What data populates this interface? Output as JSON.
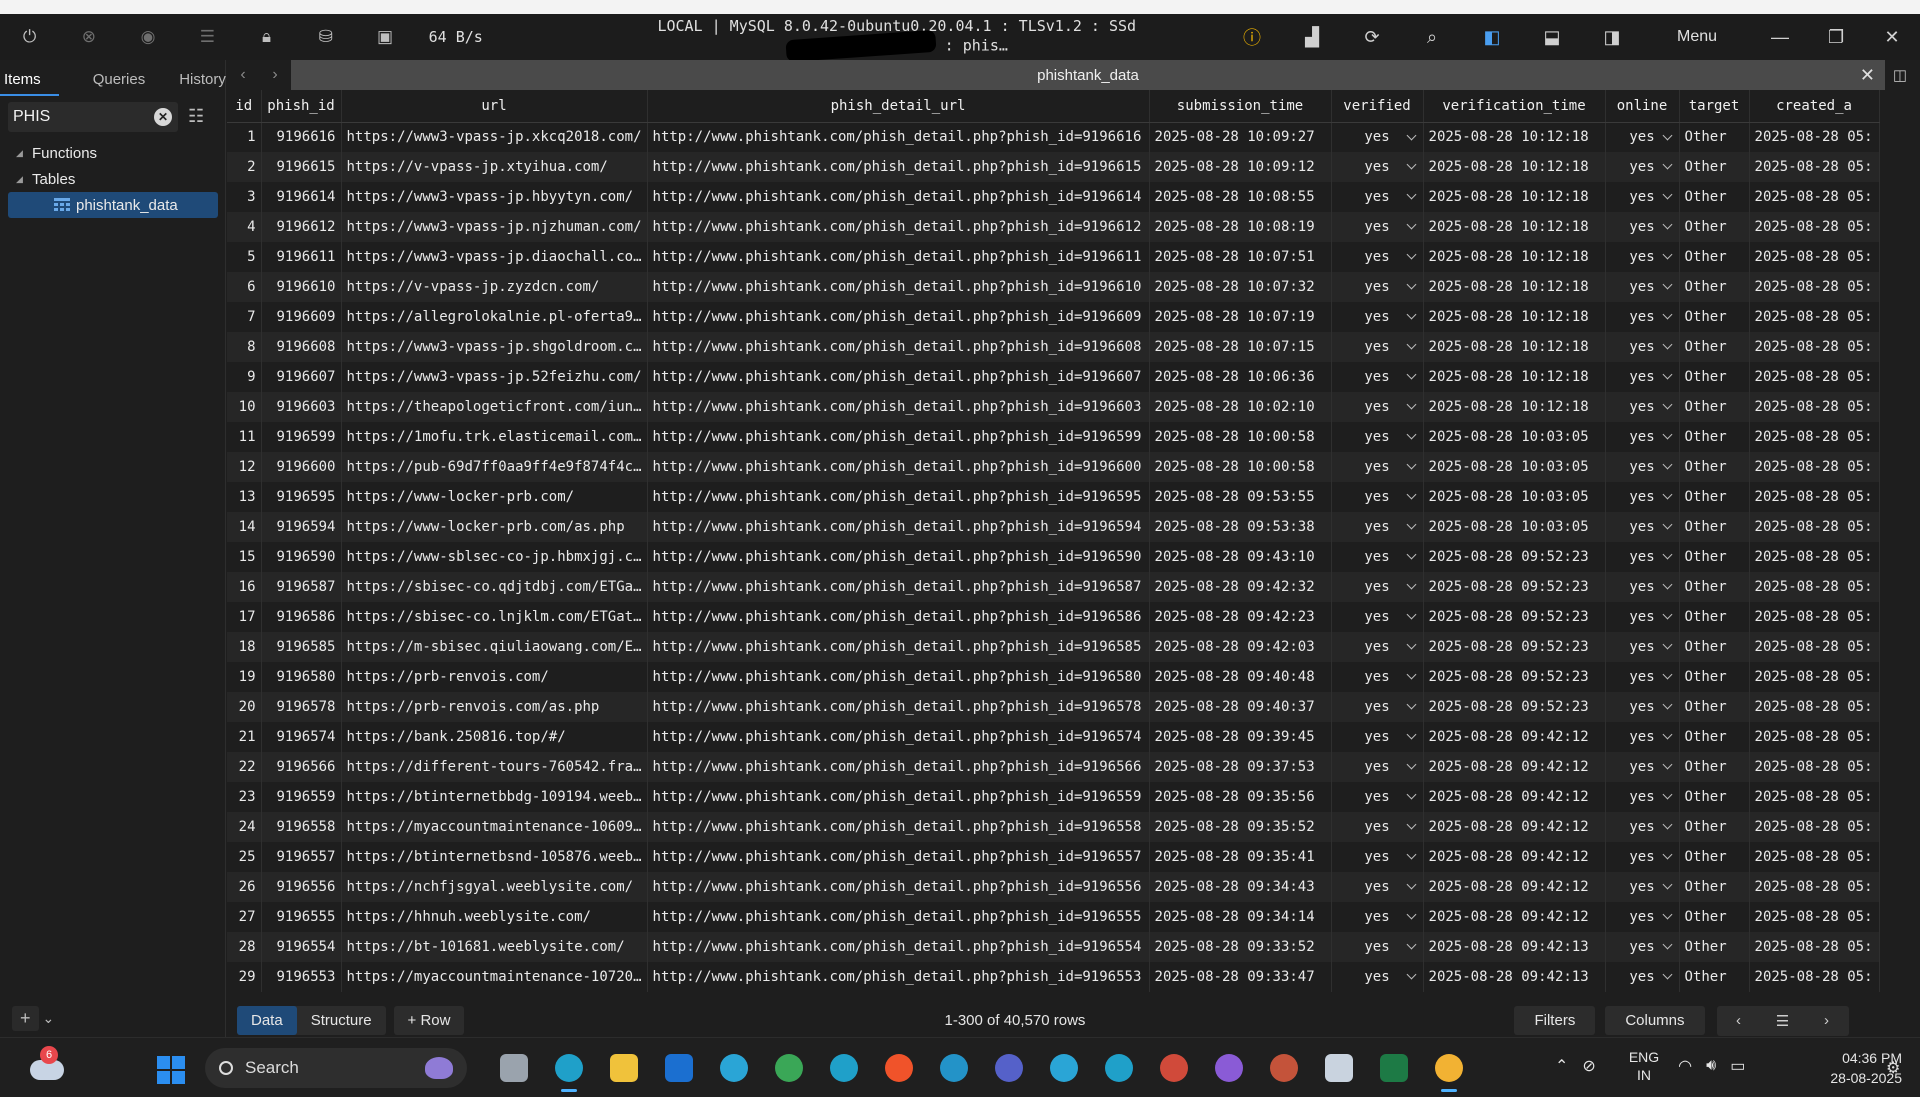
{
  "titlebar": {
    "speed": "64 B/s",
    "connection_prefix": "LOCAL | MySQL 8.0.42-0ubuntu0.20.04.1 : TLSv1.2 : SSd",
    "connection_suffix": ": phis…",
    "menu_label": "Menu",
    "icons": [
      "power-icon",
      "cancel-icon",
      "eye-icon",
      "log-icon",
      "lock-icon",
      "database-icon",
      "ssl-icon",
      "info-icon",
      "chart-icon",
      "refresh-icon",
      "search-icon",
      "layout-left-icon",
      "layout-bottom-icon",
      "layout-right-icon"
    ]
  },
  "sidebar": {
    "tabs": [
      "Items",
      "Queries",
      "History"
    ],
    "search_value": "PHIS",
    "tree": [
      {
        "label": "Functions"
      },
      {
        "label": "Tables"
      },
      {
        "label": "phishtank_data",
        "selected": true
      }
    ]
  },
  "tab": {
    "title": "phishtank_data"
  },
  "table": {
    "columns": [
      "id",
      "phish_id",
      "url",
      "phish_detail_url",
      "submission_time",
      "verified",
      "verification_time",
      "online",
      "target",
      "created_a"
    ],
    "rows": [
      [
        "1",
        "9196616",
        "https://www3-vpass-jp.xkcq2018.com/",
        "http://www.phishtank.com/phish_detail.php?phish_id=9196616",
        "2025-08-28 10:09:27",
        "yes",
        "2025-08-28 10:12:18",
        "yes",
        "Other",
        "2025-08-28 05:"
      ],
      [
        "2",
        "9196615",
        "https://v-vpass-jp.xtyihua.com/",
        "http://www.phishtank.com/phish_detail.php?phish_id=9196615",
        "2025-08-28 10:09:12",
        "yes",
        "2025-08-28 10:12:18",
        "yes",
        "Other",
        "2025-08-28 05:"
      ],
      [
        "3",
        "9196614",
        "https://www3-vpass-jp.hbyytyn.com/",
        "http://www.phishtank.com/phish_detail.php?phish_id=9196614",
        "2025-08-28 10:08:55",
        "yes",
        "2025-08-28 10:12:18",
        "yes",
        "Other",
        "2025-08-28 05:"
      ],
      [
        "4",
        "9196612",
        "https://www3-vpass-jp.njzhuman.com/",
        "http://www.phishtank.com/phish_detail.php?phish_id=9196612",
        "2025-08-28 10:08:19",
        "yes",
        "2025-08-28 10:12:18",
        "yes",
        "Other",
        "2025-08-28 05:"
      ],
      [
        "5",
        "9196611",
        "https://www3-vpass-jp.diaochall.co…",
        "http://www.phishtank.com/phish_detail.php?phish_id=9196611",
        "2025-08-28 10:07:51",
        "yes",
        "2025-08-28 10:12:18",
        "yes",
        "Other",
        "2025-08-28 05:"
      ],
      [
        "6",
        "9196610",
        "https://v-vpass-jp.zyzdcn.com/",
        "http://www.phishtank.com/phish_detail.php?phish_id=9196610",
        "2025-08-28 10:07:32",
        "yes",
        "2025-08-28 10:12:18",
        "yes",
        "Other",
        "2025-08-28 05:"
      ],
      [
        "7",
        "9196609",
        "https://allegrolokalnie.pl-oferta9…",
        "http://www.phishtank.com/phish_detail.php?phish_id=9196609",
        "2025-08-28 10:07:19",
        "yes",
        "2025-08-28 10:12:18",
        "yes",
        "Other",
        "2025-08-28 05:"
      ],
      [
        "8",
        "9196608",
        "https://www3-vpass-jp.shgoldroom.c…",
        "http://www.phishtank.com/phish_detail.php?phish_id=9196608",
        "2025-08-28 10:07:15",
        "yes",
        "2025-08-28 10:12:18",
        "yes",
        "Other",
        "2025-08-28 05:"
      ],
      [
        "9",
        "9196607",
        "https://www3-vpass-jp.52feizhu.com/",
        "http://www.phishtank.com/phish_detail.php?phish_id=9196607",
        "2025-08-28 10:06:36",
        "yes",
        "2025-08-28 10:12:18",
        "yes",
        "Other",
        "2025-08-28 05:"
      ],
      [
        "10",
        "9196603",
        "https://theapologeticfront.com/iun…",
        "http://www.phishtank.com/phish_detail.php?phish_id=9196603",
        "2025-08-28 10:02:10",
        "yes",
        "2025-08-28 10:12:18",
        "yes",
        "Other",
        "2025-08-28 05:"
      ],
      [
        "11",
        "9196599",
        "https://1mofu.trk.elasticemail.com…",
        "http://www.phishtank.com/phish_detail.php?phish_id=9196599",
        "2025-08-28 10:00:58",
        "yes",
        "2025-08-28 10:03:05",
        "yes",
        "Other",
        "2025-08-28 05:"
      ],
      [
        "12",
        "9196600",
        "https://pub-69d7ff0aa9ff4e9f874f4c…",
        "http://www.phishtank.com/phish_detail.php?phish_id=9196600",
        "2025-08-28 10:00:58",
        "yes",
        "2025-08-28 10:03:05",
        "yes",
        "Other",
        "2025-08-28 05:"
      ],
      [
        "13",
        "9196595",
        "https://www-locker-prb.com/",
        "http://www.phishtank.com/phish_detail.php?phish_id=9196595",
        "2025-08-28 09:53:55",
        "yes",
        "2025-08-28 10:03:05",
        "yes",
        "Other",
        "2025-08-28 05:"
      ],
      [
        "14",
        "9196594",
        "https://www-locker-prb.com/as.php",
        "http://www.phishtank.com/phish_detail.php?phish_id=9196594",
        "2025-08-28 09:53:38",
        "yes",
        "2025-08-28 10:03:05",
        "yes",
        "Other",
        "2025-08-28 05:"
      ],
      [
        "15",
        "9196590",
        "https://www-sblsec-co-jp.hbmxjgj.c…",
        "http://www.phishtank.com/phish_detail.php?phish_id=9196590",
        "2025-08-28 09:43:10",
        "yes",
        "2025-08-28 09:52:23",
        "yes",
        "Other",
        "2025-08-28 05:"
      ],
      [
        "16",
        "9196587",
        "https://sbisec-co.qdjtdbj.com/ETGa…",
        "http://www.phishtank.com/phish_detail.php?phish_id=9196587",
        "2025-08-28 09:42:32",
        "yes",
        "2025-08-28 09:52:23",
        "yes",
        "Other",
        "2025-08-28 05:"
      ],
      [
        "17",
        "9196586",
        "https://sbisec-co.lnjklm.com/ETGat…",
        "http://www.phishtank.com/phish_detail.php?phish_id=9196586",
        "2025-08-28 09:42:23",
        "yes",
        "2025-08-28 09:52:23",
        "yes",
        "Other",
        "2025-08-28 05:"
      ],
      [
        "18",
        "9196585",
        "https://m-sbisec.qiuliaowang.com/E…",
        "http://www.phishtank.com/phish_detail.php?phish_id=9196585",
        "2025-08-28 09:42:03",
        "yes",
        "2025-08-28 09:52:23",
        "yes",
        "Other",
        "2025-08-28 05:"
      ],
      [
        "19",
        "9196580",
        "https://prb-renvois.com/",
        "http://www.phishtank.com/phish_detail.php?phish_id=9196580",
        "2025-08-28 09:40:48",
        "yes",
        "2025-08-28 09:52:23",
        "yes",
        "Other",
        "2025-08-28 05:"
      ],
      [
        "20",
        "9196578",
        "https://prb-renvois.com/as.php",
        "http://www.phishtank.com/phish_detail.php?phish_id=9196578",
        "2025-08-28 09:40:37",
        "yes",
        "2025-08-28 09:52:23",
        "yes",
        "Other",
        "2025-08-28 05:"
      ],
      [
        "21",
        "9196574",
        "https://bank.250816.top/#/",
        "http://www.phishtank.com/phish_detail.php?phish_id=9196574",
        "2025-08-28 09:39:45",
        "yes",
        "2025-08-28 09:42:12",
        "yes",
        "Other",
        "2025-08-28 05:"
      ],
      [
        "22",
        "9196566",
        "https://different-tours-760542.fra…",
        "http://www.phishtank.com/phish_detail.php?phish_id=9196566",
        "2025-08-28 09:37:53",
        "yes",
        "2025-08-28 09:42:12",
        "yes",
        "Other",
        "2025-08-28 05:"
      ],
      [
        "23",
        "9196559",
        "https://btinternetbbdg-109194.weeb…",
        "http://www.phishtank.com/phish_detail.php?phish_id=9196559",
        "2025-08-28 09:35:56",
        "yes",
        "2025-08-28 09:42:12",
        "yes",
        "Other",
        "2025-08-28 05:"
      ],
      [
        "24",
        "9196558",
        "https://myaccountmaintenance-10609…",
        "http://www.phishtank.com/phish_detail.php?phish_id=9196558",
        "2025-08-28 09:35:52",
        "yes",
        "2025-08-28 09:42:12",
        "yes",
        "Other",
        "2025-08-28 05:"
      ],
      [
        "25",
        "9196557",
        "https://btinternetbsnd-105876.weeb…",
        "http://www.phishtank.com/phish_detail.php?phish_id=9196557",
        "2025-08-28 09:35:41",
        "yes",
        "2025-08-28 09:42:12",
        "yes",
        "Other",
        "2025-08-28 05:"
      ],
      [
        "26",
        "9196556",
        "https://nchfjsgyal.weeblysite.com/",
        "http://www.phishtank.com/phish_detail.php?phish_id=9196556",
        "2025-08-28 09:34:43",
        "yes",
        "2025-08-28 09:42:12",
        "yes",
        "Other",
        "2025-08-28 05:"
      ],
      [
        "27",
        "9196555",
        "https://hhnuh.weeblysite.com/",
        "http://www.phishtank.com/phish_detail.php?phish_id=9196555",
        "2025-08-28 09:34:14",
        "yes",
        "2025-08-28 09:42:12",
        "yes",
        "Other",
        "2025-08-28 05:"
      ],
      [
        "28",
        "9196554",
        "https://bt-101681.weeblysite.com/",
        "http://www.phishtank.com/phish_detail.php?phish_id=9196554",
        "2025-08-28 09:33:52",
        "yes",
        "2025-08-28 09:42:13",
        "yes",
        "Other",
        "2025-08-28 05:"
      ],
      [
        "29",
        "9196553",
        "https://myaccountmaintenance-10720…",
        "http://www.phishtank.com/phish_detail.php?phish_id=9196553",
        "2025-08-28 09:33:47",
        "yes",
        "2025-08-28 09:42:13",
        "yes",
        "Other",
        "2025-08-28 05:"
      ]
    ]
  },
  "footer": {
    "tabs": [
      "Data",
      "Structure"
    ],
    "add_row": "+ Row",
    "row_count": "1-300 of 40,570 rows",
    "filters": "Filters",
    "columns": "Columns"
  },
  "taskbar": {
    "weather_badge": "6",
    "search_placeholder": "Search",
    "lang_top": "ENG",
    "lang_bottom": "IN",
    "time": "04:36 PM",
    "date": "28-08-2025",
    "apps": [
      {
        "name": "task-view-app",
        "color": "#9aa3ad"
      },
      {
        "name": "edge-app",
        "color": "#1fa0c9"
      },
      {
        "name": "file-explorer-app",
        "color": "#f0c23b"
      },
      {
        "name": "outlook-app",
        "color": "#1b6fd0"
      },
      {
        "name": "edge-profile-app",
        "color": "#2aa5d6"
      },
      {
        "name": "chrome-app",
        "color": "#3aa757"
      },
      {
        "name": "edge-beta-app",
        "color": "#1fa0c9"
      },
      {
        "name": "brave-app",
        "color": "#f0532a"
      },
      {
        "name": "edge-dev-app",
        "color": "#2393c8"
      },
      {
        "name": "media-app",
        "color": "#5561c9"
      },
      {
        "name": "edge-canary-app",
        "color": "#2aa5d6"
      },
      {
        "name": "edge-work-app",
        "color": "#1fa0c9"
      },
      {
        "name": "chrome-profile-v-app",
        "color": "#d04a3a"
      },
      {
        "name": "chrome-profile-v2-app",
        "color": "#8a5bd6"
      },
      {
        "name": "chrome-profile-v3-app",
        "color": "#c4533a"
      },
      {
        "name": "snipping-tool-app",
        "color": "#c9d3df"
      },
      {
        "name": "excel-app",
        "color": "#1d7a45"
      },
      {
        "name": "tableplus-app",
        "color": "#f2b233"
      }
    ]
  }
}
